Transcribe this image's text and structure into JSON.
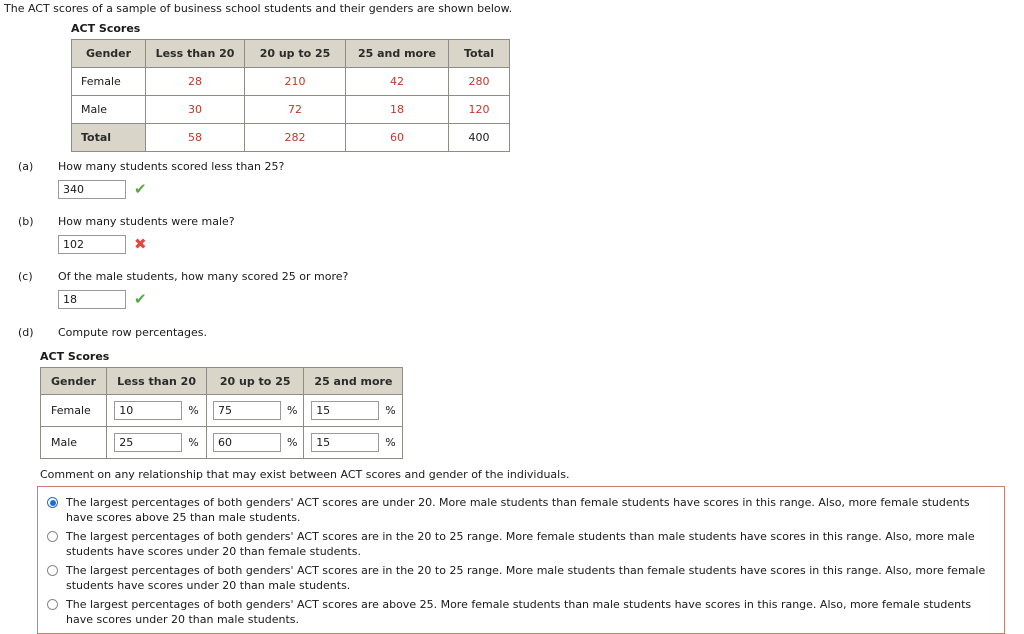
{
  "intro": "The ACT scores of a sample of business school students and their genders are shown below.",
  "counts_table": {
    "caption": "ACT Scores",
    "headers": [
      "Gender",
      "Less than 20",
      "20 up to 25",
      "25 and more",
      "Total"
    ],
    "rows": [
      {
        "label": "Female",
        "values": [
          "28",
          "210",
          "42",
          "280"
        ],
        "is_total": false
      },
      {
        "label": "Male",
        "values": [
          "30",
          "72",
          "18",
          "120"
        ],
        "is_total": false
      },
      {
        "label": "Total",
        "values": [
          "58",
          "282",
          "60",
          "400"
        ],
        "is_total": true
      }
    ]
  },
  "questions": [
    {
      "letter": "(a)",
      "text": "How many students scored less than 25?",
      "answer": "340",
      "mark": "✔",
      "mark_state": "correct"
    },
    {
      "letter": "(b)",
      "text": "How many students were male?",
      "answer": "102",
      "mark": "✖",
      "mark_state": "wrong"
    },
    {
      "letter": "(c)",
      "text": "Of the male students, how many scored 25 or more?",
      "answer": "18",
      "mark": "✔",
      "mark_state": "correct"
    }
  ],
  "part_d": {
    "letter": "(d)",
    "text": "Compute row percentages.",
    "caption": "ACT Scores",
    "headers": [
      "Gender",
      "Less than 20",
      "20 up to 25",
      "25 and more"
    ],
    "percent_sign": "%",
    "rows": [
      {
        "label": "Female",
        "values": [
          "10",
          "75",
          "15"
        ]
      },
      {
        "label": "Male",
        "values": [
          "25",
          "60",
          "15"
        ]
      }
    ]
  },
  "comment_prompt": "Comment on any relationship that may exist between ACT scores and gender of the individuals.",
  "options": [
    {
      "selected": true,
      "text": "The largest percentages of both genders' ACT scores are under 20. More male students than female students have scores in this range. Also, more female students have scores above 25 than male students."
    },
    {
      "selected": false,
      "text": "The largest percentages of both genders' ACT scores are in the 20 to 25 range. More female students than male students have scores in this range. Also, more male students have scores under 20 than female students."
    },
    {
      "selected": false,
      "text": "The largest percentages of both genders' ACT scores are in the 20 to 25 range. More male students than female students have scores in this range. Also, more female students have scores under 20 than male students."
    },
    {
      "selected": false,
      "text": "The largest percentages of both genders' ACT scores are above 25. More female students than male students have scores in this range. Also, more female students have scores under 20 than male students."
    }
  ],
  "colors": {
    "data_red": "#c0392b",
    "header_bg": "#d9d5c8",
    "correct_green": "#5aa845",
    "wrong_red": "#e0493f",
    "radio_blue": "#1f6fd0",
    "group_border": "#c87f72"
  }
}
